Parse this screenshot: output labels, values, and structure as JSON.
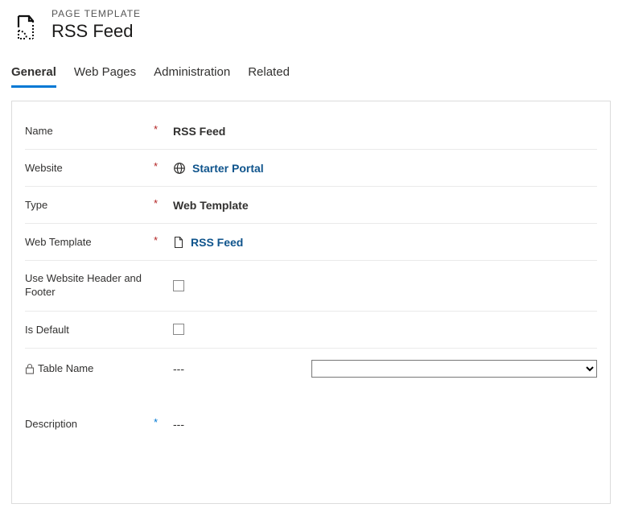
{
  "header": {
    "eyebrow": "PAGE TEMPLATE",
    "title": "RSS Feed"
  },
  "tabs": {
    "general": "General",
    "web_pages": "Web Pages",
    "administration": "Administration",
    "related": "Related",
    "active": "general"
  },
  "form": {
    "name_label": "Name",
    "name_value": "RSS Feed",
    "website_label": "Website",
    "website_value": "Starter Portal",
    "type_label": "Type",
    "type_value": "Web Template",
    "webtemplate_label": "Web Template",
    "webtemplate_value": "RSS Feed",
    "useheader_label": "Use Website Header and Footer",
    "useheader_checked": false,
    "isdefault_label": "Is Default",
    "isdefault_checked": false,
    "tablename_label": "Table Name",
    "tablename_value": "---",
    "tablename_select": "",
    "description_label": "Description",
    "description_value": "---",
    "required_marker": "*"
  }
}
